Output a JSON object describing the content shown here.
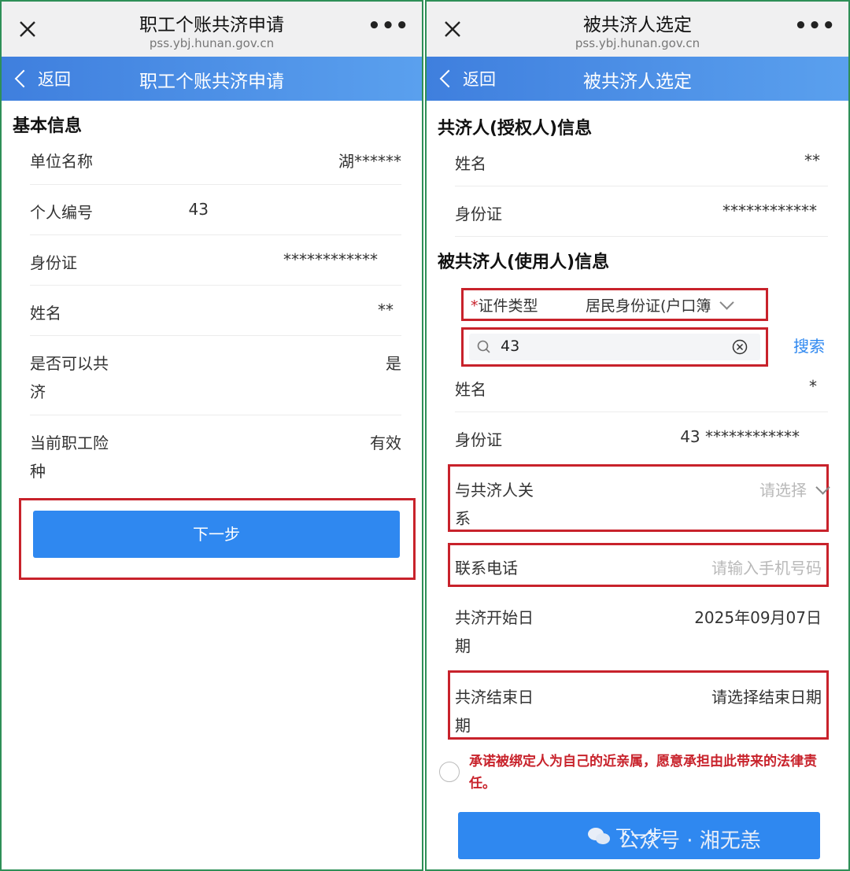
{
  "left": {
    "topbar": {
      "title": "职工个账共济申请",
      "url": "pss.ybj.hunan.gov.cn"
    },
    "navbar": {
      "back_label": "返回",
      "title": "职工个账共济申请"
    },
    "section_title": "基本信息",
    "rows": [
      {
        "label": "单位名称",
        "value": "湖******"
      },
      {
        "label": "个人编号",
        "value": "43"
      },
      {
        "label": "身份证",
        "value": "************"
      },
      {
        "label": "姓名",
        "value": "**"
      },
      {
        "label": "是否可以共",
        "label2": "济",
        "value": "是"
      },
      {
        "label": "当前职工险",
        "label2": "种",
        "value": "有效"
      }
    ],
    "next_label": "下一步"
  },
  "right": {
    "topbar": {
      "title": "被共济人选定",
      "url": "pss.ybj.hunan.gov.cn"
    },
    "navbar": {
      "back_label": "返回",
      "title": "被共济人选定"
    },
    "authorizer_title": "共济人(授权人)信息",
    "authorizer_rows": [
      {
        "label": "姓名",
        "value": "**"
      },
      {
        "label": "身份证",
        "value": "************"
      }
    ],
    "beneficiary_title": "被共济人(使用人)信息",
    "id_type": {
      "required_mark": "*",
      "label": "证件类型",
      "value": "居民身份证(户口簿"
    },
    "search": {
      "value": "43",
      "button": "搜索"
    },
    "beneficiary_rows": [
      {
        "label": "姓名",
        "value": "*"
      },
      {
        "label": "身份证",
        "value": "43  ************"
      }
    ],
    "relation": {
      "label": "与共济人关",
      "label2": "系",
      "placeholder": "请选择"
    },
    "phone": {
      "label": "联系电话",
      "placeholder": "请输入手机号码"
    },
    "start_date": {
      "label": "共济开始日",
      "label2": "期",
      "value": "2025年09月07日"
    },
    "end_date": {
      "label": "共济结束日",
      "label2": "期",
      "value": "请选择结束日期"
    },
    "agreement_text": "承诺被绑定人为自己的近亲属，愿意承担由此带来的法律责任。",
    "next_label": "下一步",
    "watermark": "公众号 · 湘无恙"
  },
  "icons": [
    "close-icon",
    "more-icon",
    "back-chevron-icon",
    "chevron-down-icon",
    "search-icon",
    "clear-icon",
    "radio-icon",
    "wechat-icon"
  ],
  "colors": {
    "nav_blue": "#3f7fde",
    "button_blue": "#2f88f0",
    "highlight_red": "#c8222b",
    "frame_green": "#2e8f57"
  }
}
